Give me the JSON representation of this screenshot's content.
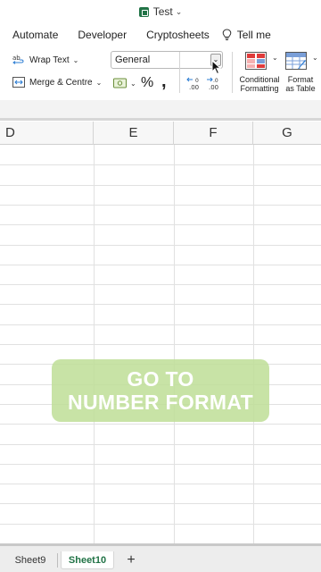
{
  "window": {
    "title": "Test"
  },
  "tabs": [
    "Automate",
    "Developer",
    "Cryptosheets"
  ],
  "tell_me": "Tell me",
  "ribbon": {
    "wrap_text": "Wrap Text",
    "merge_centre": "Merge & Centre",
    "number_format": {
      "value": "General"
    },
    "percent_symbol": "%",
    "comma_symbol": ",",
    "decrease_decimal_label": ".00",
    "increase_decimal_label": ".00",
    "conditional_formatting": [
      "Conditional",
      "Formatting"
    ],
    "format_as_table": [
      "Format",
      "as Table"
    ]
  },
  "columns": [
    "D",
    "E",
    "F",
    "G"
  ],
  "overlay": {
    "line1": "GO TO",
    "line2": "NUMBER FORMAT"
  },
  "sheets": {
    "tabs": [
      "Sheet9",
      "Sheet10"
    ],
    "active": "Sheet10",
    "add_label": "+"
  },
  "colors": {
    "excel_green": "#217346",
    "overlay_green": "#bedc96"
  }
}
